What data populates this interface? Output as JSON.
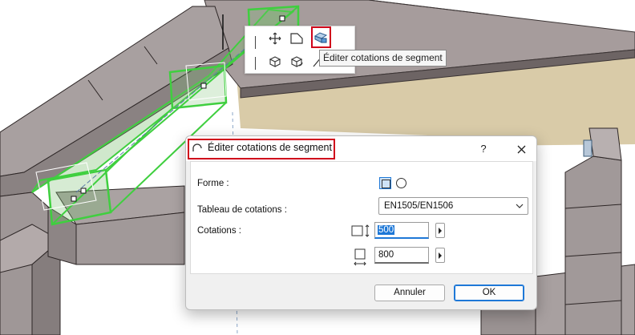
{
  "scene": {
    "description_icon": "3d-beam-viewport"
  },
  "palette": {
    "icons": [
      "line-divider-icon",
      "move-icon",
      "profile-shape-icon",
      "edit-segment-dimensions-icon",
      "move-3d-icon",
      "rotate-3d-icon",
      "offset-icon"
    ],
    "tooltip": "Éditer cotations de segment"
  },
  "dialog": {
    "title": "Éditer cotations de segment",
    "help": "?",
    "forme_label": "Forme :",
    "tableau_label": "Tableau de cotations :",
    "tableau_value": "EN1505/EN1506",
    "cotations_label": "Cotations :",
    "dim1_value": "500",
    "dim2_value": "800",
    "cancel_label": "Annuler",
    "ok_label": "OK"
  },
  "colors": {
    "accent": "#1e78d7",
    "highlight": "#d0021b",
    "selection": "#3fcf3f"
  }
}
